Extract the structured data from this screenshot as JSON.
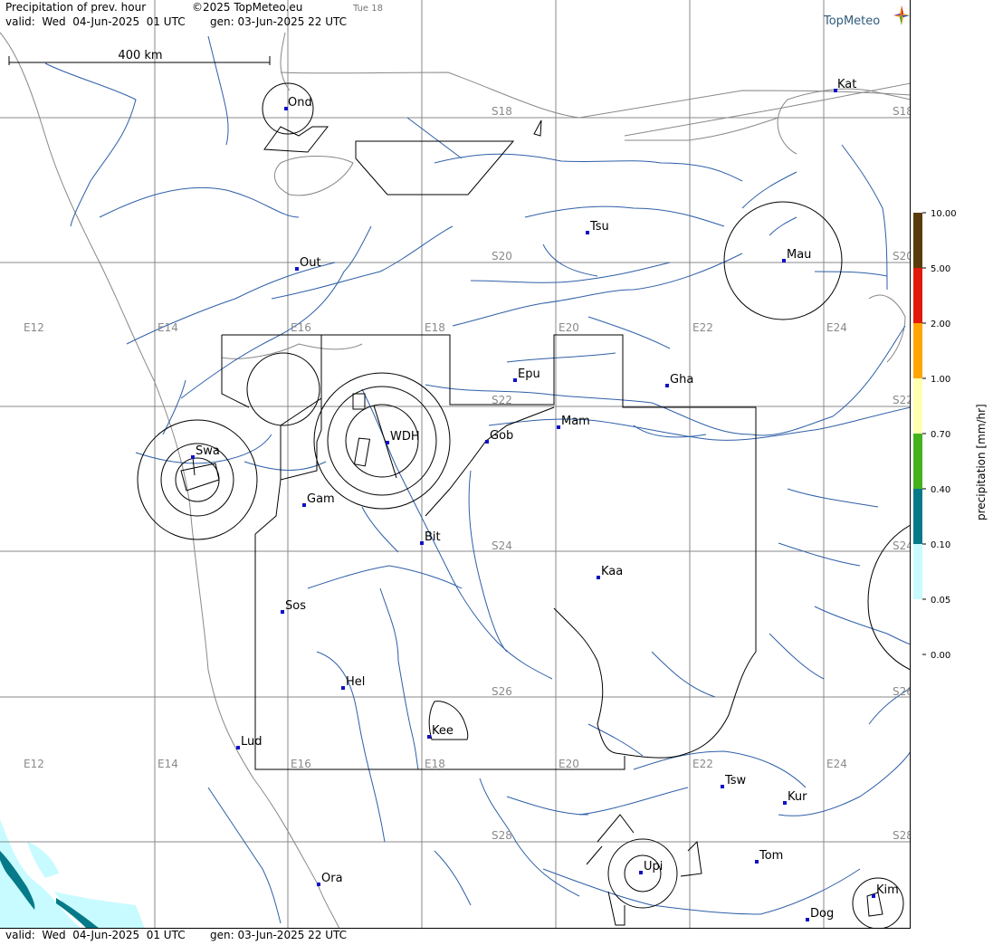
{
  "header": {
    "title": "Precipitation of prev. hour",
    "copyright": "©2025 TopMeteo.eu",
    "tab_label": "Tue 18",
    "valid_label": "valid:  Wed  04-Jun-2025  01 UTC",
    "gen_label": "gen: 03-Jun-2025 22 UTC"
  },
  "footer": {
    "valid_label": "valid:  Wed  04-Jun-2025  01 UTC",
    "gen_label": "gen: 03-Jun-2025 22 UTC"
  },
  "logo": {
    "text": "TopMeteo",
    "color": "#2e5b7a"
  },
  "scale_bar": {
    "label": "400 km"
  },
  "grid_labels": {
    "lon": [
      "E12",
      "E14",
      "E16",
      "E18",
      "E20",
      "E22",
      "E24"
    ],
    "lat": [
      "S18",
      "S20",
      "S22",
      "S24",
      "S26",
      "S28"
    ]
  },
  "cities": [
    {
      "id": "ond",
      "label": "Ond"
    },
    {
      "id": "kat",
      "label": "Kat"
    },
    {
      "id": "out",
      "label": "Out"
    },
    {
      "id": "tsu",
      "label": "Tsu"
    },
    {
      "id": "mau",
      "label": "Mau"
    },
    {
      "id": "epu",
      "label": "Epu"
    },
    {
      "id": "gha",
      "label": "Gha"
    },
    {
      "id": "mam",
      "label": "Mam"
    },
    {
      "id": "gob",
      "label": "Gob"
    },
    {
      "id": "wdh",
      "label": "WDH"
    },
    {
      "id": "swa",
      "label": "Swa"
    },
    {
      "id": "gam",
      "label": "Gam"
    },
    {
      "id": "bit",
      "label": "Bit"
    },
    {
      "id": "kaa",
      "label": "Kaa"
    },
    {
      "id": "sos",
      "label": "Sos"
    },
    {
      "id": "hel",
      "label": "Hel"
    },
    {
      "id": "kee",
      "label": "Kee"
    },
    {
      "id": "lud",
      "label": "Lud"
    },
    {
      "id": "tsw",
      "label": "Tsw"
    },
    {
      "id": "kur",
      "label": "Kur"
    },
    {
      "id": "tom",
      "label": "Tom"
    },
    {
      "id": "upi",
      "label": "Upi"
    },
    {
      "id": "ora",
      "label": "Ora"
    },
    {
      "id": "kim",
      "label": "Kim"
    },
    {
      "id": "dog",
      "label": "Dog"
    }
  ],
  "legend": {
    "title": "precipitation [mm/hr]",
    "levels": [
      {
        "label": "10.00",
        "color": "#5a3c0a"
      },
      {
        "label": "5.00",
        "color": "#e01a0a"
      },
      {
        "label": "2.00",
        "color": "#ffa500"
      },
      {
        "label": "1.00",
        "color": "#ffffb0"
      },
      {
        "label": "0.70",
        "color": "#44b21c"
      },
      {
        "label": "0.40",
        "color": "#067a88"
      },
      {
        "label": "0.10",
        "color": "#c8fbff"
      },
      {
        "label": "0.05",
        "color": "#ffffff"
      },
      {
        "label": "0.00",
        "color": "#ffffff"
      }
    ]
  },
  "colors": {
    "river": "#2e5fa8",
    "grid": "#888888",
    "coast": "#8a8a8a",
    "city_dot": "#1010c8",
    "precip_light": "#c8fbff",
    "precip_mid": "#067a88"
  }
}
